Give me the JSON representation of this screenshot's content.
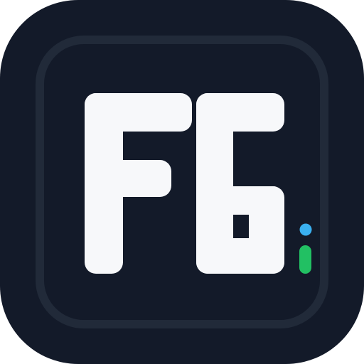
{
  "app_icon": {
    "monogram": "FG",
    "colors": {
      "tile_background": "#131a29",
      "inner_frame": "#212a39",
      "letters": "#f7f8fa",
      "dot_blue": "#3ab0f0",
      "dot_green": "#22c063"
    },
    "icons": [
      "fg-monogram-icon",
      "blue-dot-icon",
      "green-bar-icon"
    ]
  }
}
